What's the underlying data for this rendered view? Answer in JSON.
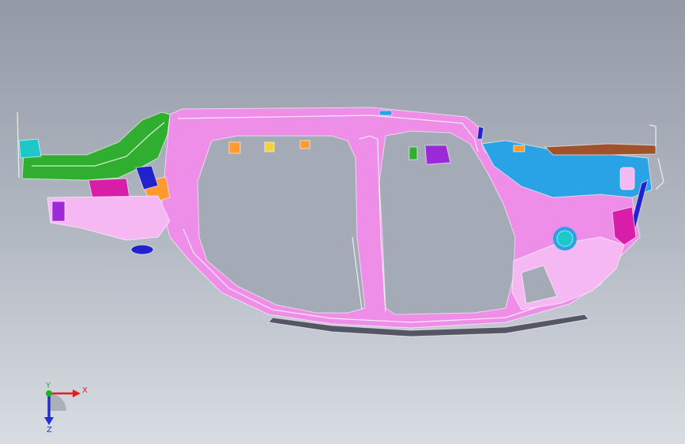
{
  "viewport": {
    "background_top": "#939aa6",
    "background_bottom": "#d9dde3"
  },
  "model": {
    "colors": {
      "body_side": "#ee8ee8",
      "body_side_light": "#f6b8f2",
      "body_outline": "#ffffff",
      "front_rail": "#2fae2f",
      "rear_panel": "#2aa3e6",
      "rear_top": "#a0522d",
      "bracket_orange": "#ff9a2e",
      "bracket_magenta": "#d81ea8",
      "bracket_blue": "#2222cc",
      "bracket_purple": "#9b2ad6",
      "sill_dark": "#555566",
      "teal": "#1ec8c8",
      "yellow": "#f2d23a"
    }
  },
  "triad": {
    "x_label": "X",
    "y_label": "Y",
    "z_label": "Z",
    "x_color": "#e02020",
    "y_color": "#20b020",
    "z_color": "#2030d0"
  }
}
